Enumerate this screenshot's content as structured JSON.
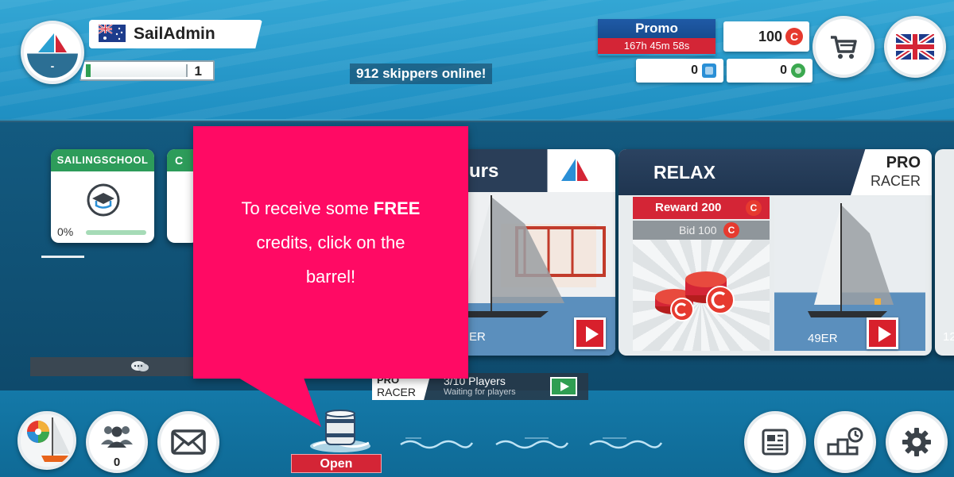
{
  "profile": {
    "name": "SailAdmin",
    "rank": "-",
    "level": "1"
  },
  "online_text": "912 skippers online!",
  "promo": {
    "title": "Promo",
    "timer": "167h 45m 58s"
  },
  "currency": {
    "credits": "100",
    "credit_symbol": "C",
    "gems": "0",
    "tokens": "0"
  },
  "modes": {
    "sailing_school": {
      "title": "SAILINGSCHOOL",
      "progress": "0%"
    },
    "second_mode": {
      "title_partial": "C"
    },
    "tours": {
      "title_partial": "urs",
      "boat_class_partial": "ER"
    },
    "relax": {
      "title": "RELAX",
      "tag_top": "PRO",
      "tag_bottom": "RACER",
      "reward": "Reward 200",
      "bid": "Bid 100",
      "boat_class": "49ER"
    },
    "edge_partial": "12"
  },
  "waiting_lobby": {
    "tag_top": "PRO",
    "tag_bottom": "RACER",
    "players": "3/10 Players",
    "status": "Waiting for players"
  },
  "tooltip": {
    "line1": "To receive some ",
    "line1_bold": "FREE",
    "line2": "credits, click on the",
    "line3": "barrel!"
  },
  "barrel": {
    "button_label": "Open"
  },
  "friends": {
    "count": "0"
  },
  "colors": {
    "tooltip": "#ff0a64",
    "accent_red": "#d42536",
    "promo_blue": "#1f5aa6",
    "school_green": "#2d9c5a",
    "header_navy": "#2b4361"
  }
}
